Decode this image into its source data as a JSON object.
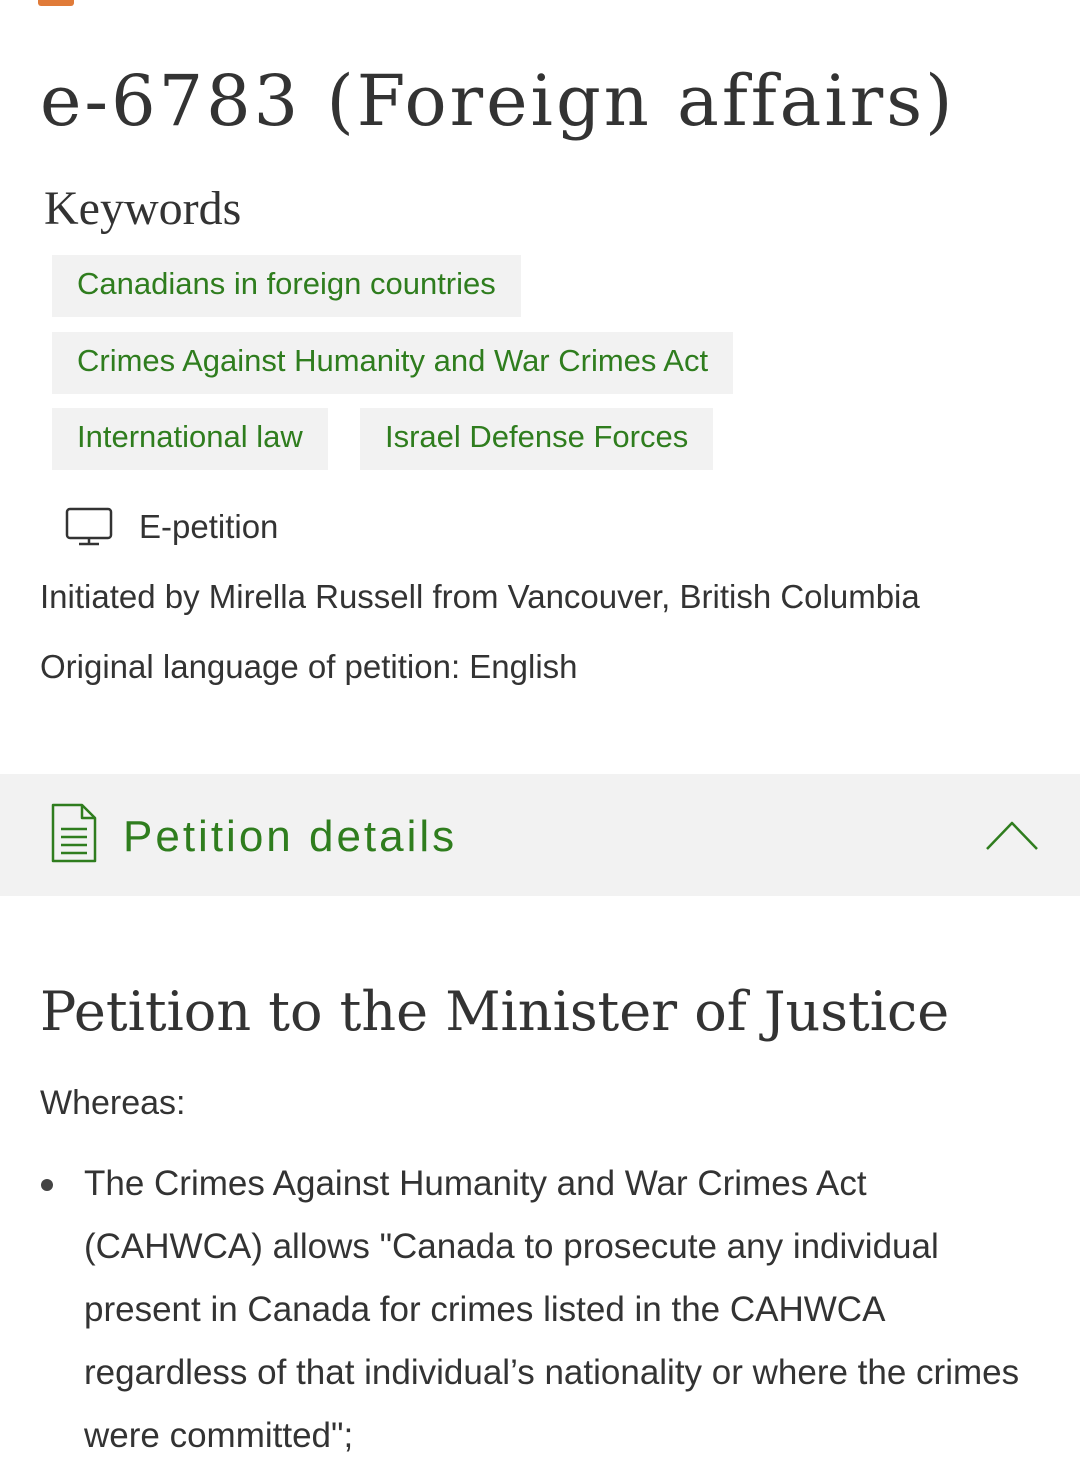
{
  "petition": {
    "title": "e-6783 (Foreign affairs)",
    "keywords_heading": "Keywords",
    "keywords": [
      "Canadians in foreign countries",
      "Crimes Against Humanity and War Crimes Act",
      "International law",
      "Israel Defense Forces"
    ],
    "type_label": "E-petition",
    "type_icon": "monitor-icon",
    "initiated_by": "Initiated by Mirella Russell from Vancouver, British Columbia",
    "original_language": "Original language of petition: English"
  },
  "details_section": {
    "label": "Petition details",
    "icon": "document-icon",
    "toggle_icon": "chevron-up-icon",
    "accent_color": "#2f7d1e",
    "bar_color": "#f2f2f2"
  },
  "body": {
    "heading": "Petition to the Minister of Justice",
    "whereas": "Whereas:",
    "bullets": [
      "The Crimes Against Humanity and War Crimes Act (CAHWCA) allows \"Canada to prosecute any individual present in Canada for crimes listed in the CAHWCA regardless of that individual’s nationality or where the crimes were committed\";"
    ]
  }
}
